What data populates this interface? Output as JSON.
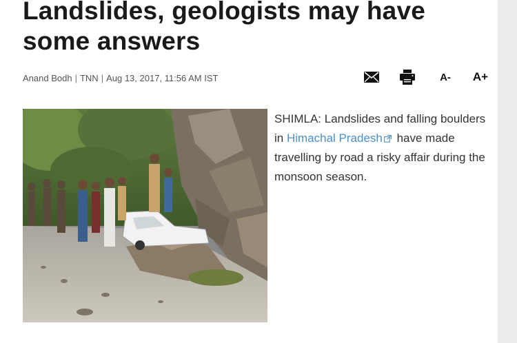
{
  "article": {
    "headline": "Landslides, geologists may have some answers",
    "byline": {
      "author": "Anand Bodh",
      "source": "TNN",
      "datetime": "Aug 13, 2017, 11:56 AM IST"
    },
    "tools": {
      "font_decrease": "A-",
      "font_increase": "A+"
    },
    "body": {
      "lead_before_link": "SHIMLA: Landslides and falling boulders in ",
      "link_text": "Himachal Pradesh",
      "lead_after_link": " have made travelling by road a risky affair during the monsoon season."
    }
  },
  "icons": {
    "mail": "mail-icon",
    "print": "print-icon",
    "external_link": "external-link-icon"
  },
  "colors": {
    "link": "#4a90c8",
    "headline": "#1a1a1a",
    "byline": "#555555",
    "body_text": "#333333"
  }
}
